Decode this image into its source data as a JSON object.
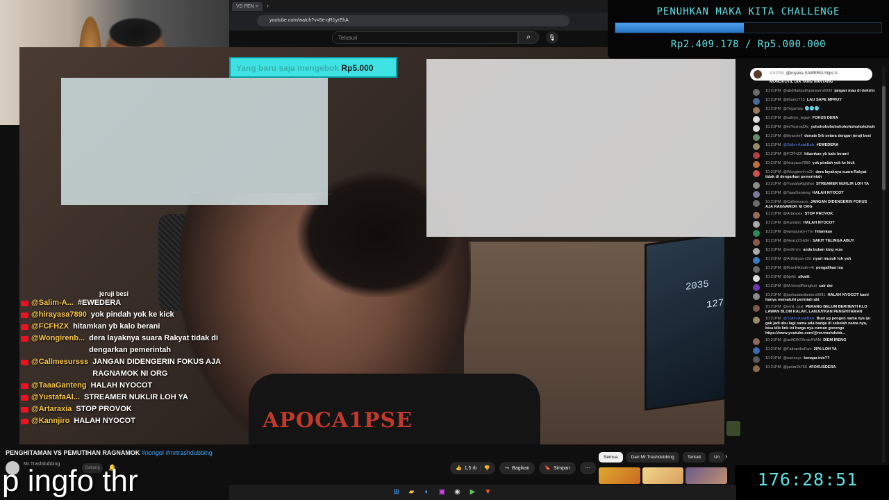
{
  "browser": {
    "tab_label": "VS PEN",
    "new_tab": "+",
    "close_tab": "×",
    "url": "youtube.com/watch?v=5e-qR1yrEhA"
  },
  "youtube": {
    "search_placeholder": "Telusuri"
  },
  "donation_banner": {
    "faded_text": "Yang baru saja mengebok",
    "amount": "Rp5.000"
  },
  "challenge": {
    "title": "PENUHKAN MAKA KITA CHALLENGE",
    "current": "Rp2.409.178",
    "target": "Rp5.000.000",
    "progress": 0.4818,
    "amount_text": "Rp2.409.178 / Rp5.000.000"
  },
  "video_chat": [
    {
      "name": "",
      "msg": "jeruji besi"
    },
    {
      "name": "@Salim-A...",
      "msg": "#EWEDERA"
    },
    {
      "name": "@hirayasa7890",
      "msg": "yok pindah yok ke kick"
    },
    {
      "name": "@FCFHZX",
      "msg": "hitamkan yb kalo berani"
    },
    {
      "name": "@Wongirenb...",
      "msg": "dera layaknya suara Rakyat tidak di dengarkan pemerintah"
    },
    {
      "name": "@Callmesursss",
      "msg": "JANGAN DIDENGERIN FOKUS AJA RAGNAMOK NI ORG"
    },
    {
      "name": "@TaaaGanteng",
      "msg": "HALAH NYOCOT"
    },
    {
      "name": "@YustafaAl...",
      "msg": "STREAMER NUKLIR LOH YA"
    },
    {
      "name": "@Artaraxia",
      "msg": "STOP PROVOK"
    },
    {
      "name": "@Kannjiro",
      "msg": "HALAH NYOCOT"
    }
  ],
  "chat_panel": {
    "top_text": "@iniyaha  SAWERIA https://...",
    "top_time": "4:52PM",
    "messages": [
      {
        "time": "",
        "name": "",
        "msg": "MONOKOTIL DIA YANG NANTANG",
        "color": "#8a8a8a"
      },
      {
        "time": "10:21PM",
        "name": "@abdillahpatihparawira6093",
        "msg": "jangan mau di doktrin",
        "color": "#6b6b6b"
      },
      {
        "time": "10:21PM",
        "name": "@ilham1715",
        "msg": "LAU SAPE MPRUY",
        "color": "#4a6a9a"
      },
      {
        "time": "10:21PM",
        "name": "@Tegarfsla",
        "msg": "🥶🥶🥶",
        "color": "#9a7a5a"
      },
      {
        "time": "10:21PM",
        "name": "@satriyo_teguh",
        "msg": "FOKUS DERA",
        "color": "#dddddd"
      },
      {
        "time": "10:21PM",
        "name": "@iniYusmaOfc",
        "msg": "yohohohohohohohohohohohohohohohohohohohohohohohohohohohohohoh",
        "color": "#dddddd"
      },
      {
        "time": "10:21PM",
        "name": "@iliyasviell",
        "msg": "donate 5rb setara dengan jeruji besi",
        "color": "#6a8a6a"
      },
      {
        "time": "10:21PM",
        "name": "@Salim-AnakBaik",
        "msg": "#EWEDERA",
        "color": "#9a8a6a",
        "mod": true
      },
      {
        "time": "10:21PM",
        "name": "@FCFHZX",
        "msg": "hitamkan yb kalo berani",
        "color": "#b04040"
      },
      {
        "time": "10:21PM",
        "name": "@hirayasa7890",
        "msg": "yok pindah yok ke kick",
        "color": "#c07040"
      },
      {
        "time": "10:21PM",
        "name": "@Wongirenh-o2h",
        "msg": "dera layaknya suara Rakyat tidak di dengarkan pemerintah",
        "color": "#d05050"
      },
      {
        "time": "10:21PM",
        "name": "@YustafaAlghifari",
        "msg": "STREAMER NUKLIR LOH YA",
        "color": "#8a8a8a"
      },
      {
        "time": "10:21PM",
        "name": "@TaaaGanteng",
        "msg": "HALAH NYOCOT",
        "color": "#7a7a9a"
      },
      {
        "time": "10:21PM",
        "name": "@Callmesurss",
        "msg": "JANGAN DIDENGERIN FOKUS AJA RAGNAMOK NI ORG",
        "color": "#6a6a6a"
      },
      {
        "time": "10:21PM",
        "name": "@Artaraxia",
        "msg": "STOP PROVOK",
        "color": "#9a6a5a"
      },
      {
        "time": "10:21PM",
        "name": "@Kannjiro",
        "msg": "HALAH NYOCOT",
        "color": "#aaaaaa"
      },
      {
        "time": "10:21PM",
        "name": "@epepjunior-r7m",
        "msg": "hitamkan",
        "color": "#2a8a5a"
      },
      {
        "time": "10:21PM",
        "name": "@Nearz23-b9m",
        "msg": "SAKIT TELINGA ABUY",
        "color": "#8a5a4a"
      },
      {
        "time": "10:21PM",
        "name": "@noifrrrrrr",
        "msg": "anda bukan king reza",
        "color": "#aaaaaa"
      },
      {
        "time": "10:21PM",
        "name": "@Arifiniiyas-x2d",
        "msg": "nyari musuh loh yah",
        "color": "#3a7ac0"
      },
      {
        "time": "10:21PM",
        "name": "@RianHikmah-r4t",
        "msg": "pengalihan isu",
        "color": "#6a6a6a"
      },
      {
        "time": "10:21PM",
        "name": "@bjekk",
        "msg": "sikattt",
        "color": "#dddddd"
      },
      {
        "time": "10:21PM",
        "name": "@M.IsmailRangkuti",
        "msg": "cair der",
        "color": "#6a3ab0"
      },
      {
        "time": "10:21PM",
        "name": "@joshuadarilantoro9981",
        "msg": "HALAH NYOCOT kami hanya mematuhi perintah abi",
        "color": "#8a8a8a"
      },
      {
        "time": "10:21PM",
        "name": "@emil_cast",
        "msg": "PERANG BELUM BERHENTI KLO LAWAN BLOM KALAH, LANJUTKAN PENGHITAMAN",
        "color": "#7a5a4a"
      },
      {
        "time": "10:21PM",
        "name": "@Salim-AnakBaik",
        "msg": "Bust yg pengen nama nya ijo gak jadi abu lagi sama ada badge di sebelah nama nya, bisa klik link ini harga nya cuman gocengs https://www.youtube.com/@mr.trashdubb...",
        "color": "#9a8a6a",
        "mod": true
      },
      {
        "time": "10:21PM",
        "name": "@aellCINTAmieAYAM",
        "msg": "DIEM IRENG",
        "color": "#8a6a5a"
      },
      {
        "time": "10:21PM",
        "name": "@FathanikuFani",
        "msg": "30% LOH YA",
        "color": "#3a6ab0"
      },
      {
        "time": "10:21PM",
        "name": "@nanaeyc",
        "msg": "kenapa inie??",
        "color": "#5a5a5a"
      },
      {
        "time": "10:21PM",
        "name": "@justar2k756",
        "msg": "#FOKUSDERA",
        "color": "#8a6a4a"
      }
    ]
  },
  "video": {
    "title": "PENGHITAMAN VS PEMUTIHAN RAGNAMOK",
    "tags": "#nongol #mrtrashdubbing",
    "channel": "Mr.Trashdubbing",
    "subscribe": "Gabung",
    "subtitle": "p ingfo thr",
    "shirt_print": "APOCA1PSE",
    "monitor_numbers": [
      "2035",
      "127"
    ]
  },
  "actions": {
    "likes": "1,5 rb",
    "share": "Bagikan",
    "save": "Simpan",
    "more": "⋯"
  },
  "reco_tabs": [
    "Semua",
    "Dari Mr.Trashdubbing",
    "Terkait",
    "Un"
  ],
  "timer": "176:28:51",
  "icons": {
    "search": "search-icon",
    "mic": "mic-icon",
    "like": "thumbs-up-icon",
    "dislike": "thumbs-down-icon",
    "share": "share-icon",
    "save": "bookmark-icon",
    "bell": "bell-icon"
  },
  "colors": {
    "accent_cyan": "#5ee2e6",
    "progress_blue": "#3a8ad8",
    "youtube_red": "#ff0000",
    "chat_name_yellow": "#f5c542"
  }
}
